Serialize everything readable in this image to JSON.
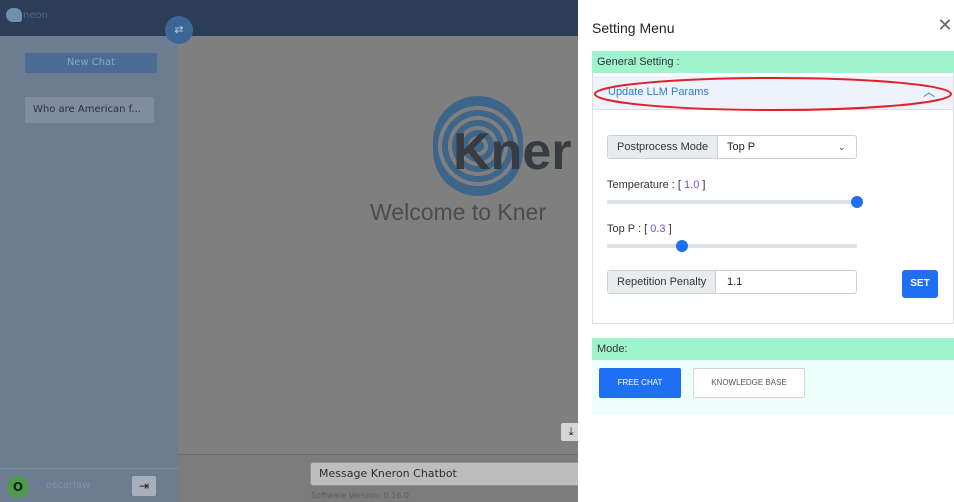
{
  "app": {
    "logo_text": "neon",
    "sidebar": {
      "new_chat_label": "New Chat",
      "swap_icon": "⇄",
      "chat_items": [
        "Who are American f..."
      ],
      "user": {
        "avatar_letter": "O",
        "username": "oscarlaw"
      },
      "logout_icon": "⇥"
    },
    "main": {
      "brand_text": "Kner",
      "welcome_text": "Welcome to Kner",
      "download_icon": "⤓",
      "message_placeholder": "Message Kneron Chatbot",
      "software_version": "Software Version: 0.16.0"
    }
  },
  "settings": {
    "title": "Setting Menu",
    "close_icon": "✕",
    "general": {
      "header": "General Setting :",
      "accordion_label": "Update LLM Params",
      "accordion_chevron": "︿",
      "postprocess": {
        "label": "Postprocess Mode",
        "value": "Top P",
        "chevron": "⌄"
      },
      "temperature": {
        "label": "Temperature : ",
        "value": "1.0",
        "fraction": 1.0
      },
      "top_p": {
        "label": "Top P : ",
        "value": "0.3",
        "fraction": 0.3
      },
      "repetition_penalty": {
        "label": "Repetition Penalty",
        "value": "1.1"
      },
      "set_button": "SET"
    },
    "mode": {
      "header": "Mode:",
      "free_chat_label": "FREE CHAT",
      "knowledge_base_label": "KNOWLEDGE BASE"
    }
  },
  "colors": {
    "accent": "#1f6ff2",
    "section_header": "#9ff4cd",
    "highlight": "#e0202a",
    "param_value": "#7b4fd1"
  }
}
